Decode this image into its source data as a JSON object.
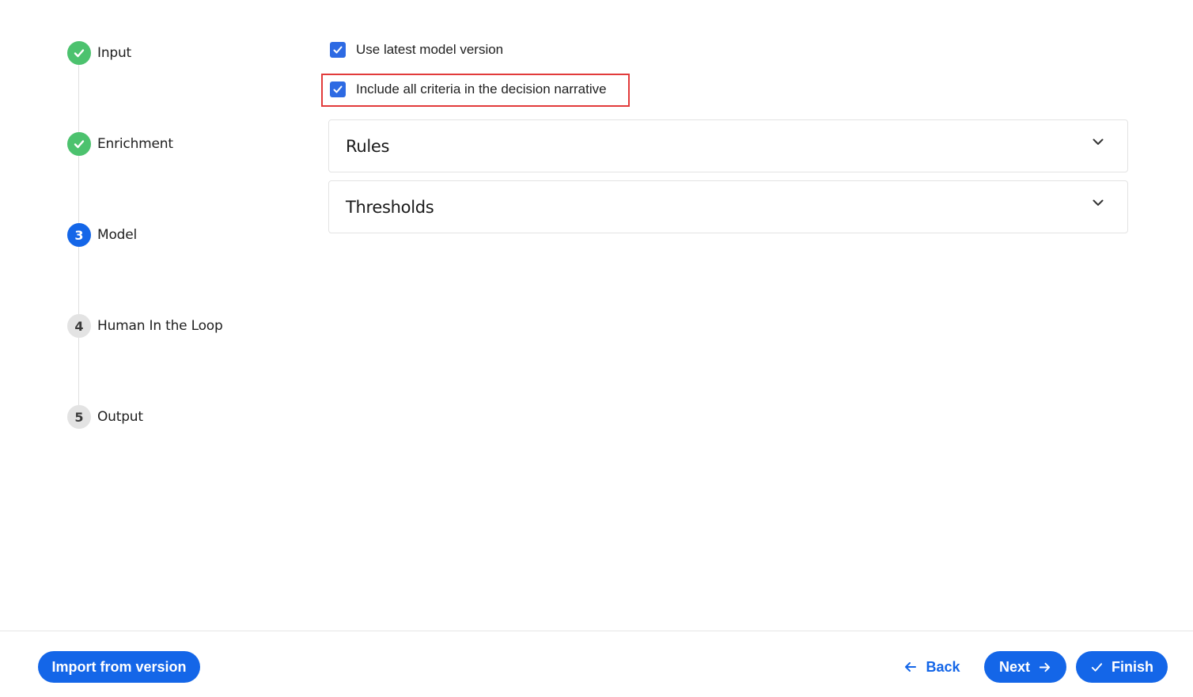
{
  "stepper": {
    "steps": [
      {
        "label": "Input",
        "status": "done",
        "number": ""
      },
      {
        "label": "Enrichment",
        "status": "done",
        "number": ""
      },
      {
        "label": "Model",
        "status": "active",
        "number": "3"
      },
      {
        "label": "Human In the Loop",
        "status": "pending",
        "number": "4"
      },
      {
        "label": "Output",
        "status": "pending",
        "number": "5"
      }
    ]
  },
  "options": {
    "use_latest": {
      "label": "Use latest model version",
      "checked": true
    },
    "include_criteria": {
      "label": "Include all criteria in the decision narrative",
      "checked": true
    }
  },
  "sections": [
    {
      "title": "Rules"
    },
    {
      "title": "Thresholds"
    }
  ],
  "footer": {
    "import_label": "Import from version",
    "back_label": "Back",
    "next_label": "Next",
    "finish_label": "Finish"
  },
  "colors": {
    "primary": "#1466e8",
    "done": "#4cc26e",
    "pending": "#e3e3e3",
    "highlight": "#e23b3b"
  }
}
